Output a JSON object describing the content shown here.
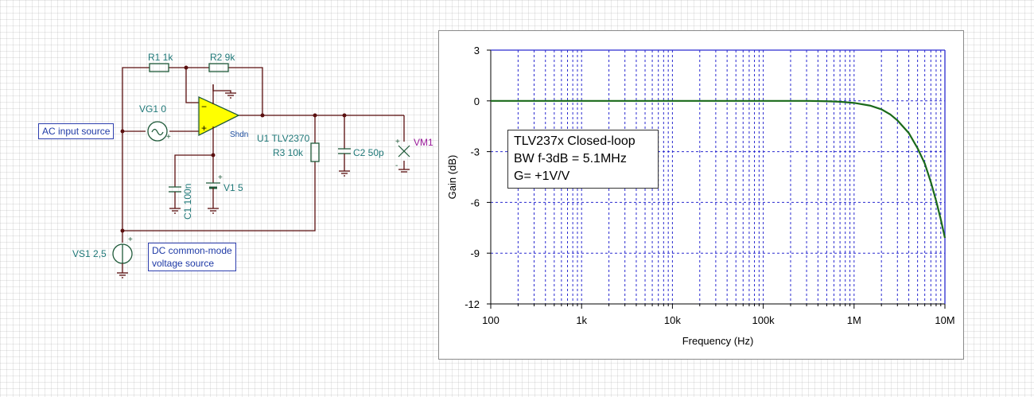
{
  "schematic": {
    "components": {
      "r1": "R1 1k",
      "r2": "R2 9k",
      "vg1": "VG1 0",
      "u1": "U1 TLV2370",
      "shdn": "Shdn",
      "r3": "R3 10k",
      "c2": "C2 50p",
      "vm1": "VM1",
      "c1": "C1 100n",
      "v1": "V1 5",
      "vs1": "VS1 2,5"
    },
    "text_boxes": {
      "ac_input": "AC input source",
      "dc_line1": "DC common-mode",
      "dc_line2": "voltage source"
    }
  },
  "colors": {
    "wire": "#5a0f0f",
    "component": "#1f5a3a",
    "label": "#1f7878",
    "opamp_fill": "#ffff00",
    "meter_label": "#9a1b9a",
    "grid": "#2a2ad0",
    "trace": "#1a6a1a"
  },
  "chart_data": {
    "type": "line",
    "x_scale": "log",
    "xlabel": "Frequency (Hz)",
    "ylabel": "Gain (dB)",
    "xlim": [
      100,
      10000000
    ],
    "ylim": [
      -12,
      3
    ],
    "x_ticks": [
      {
        "value": 100,
        "label": "100"
      },
      {
        "value": 1000,
        "label": "1k"
      },
      {
        "value": 10000,
        "label": "10k"
      },
      {
        "value": 100000,
        "label": "100k"
      },
      {
        "value": 1000000,
        "label": "1M"
      },
      {
        "value": 10000000,
        "label": "10M"
      }
    ],
    "y_ticks": [
      {
        "value": 3,
        "label": "3"
      },
      {
        "value": 0,
        "label": "0"
      },
      {
        "value": -3,
        "label": "-3"
      },
      {
        "value": -6,
        "label": "-6"
      },
      {
        "value": -9,
        "label": "-9"
      },
      {
        "value": -12,
        "label": "-12"
      }
    ],
    "grid": true,
    "series": [
      {
        "x": [
          100,
          1000,
          10000,
          100000,
          300000,
          500000,
          700000,
          1000000,
          1500000,
          2000000,
          2500000,
          3000000,
          4000000,
          5000000,
          6000000,
          7000000,
          8000000,
          9000000,
          10000000
        ],
        "values": [
          0,
          0,
          0,
          0,
          0,
          -0.02,
          -0.05,
          -0.12,
          -0.28,
          -0.5,
          -0.8,
          -1.15,
          -1.9,
          -2.8,
          -3.7,
          -4.8,
          -5.9,
          -7.0,
          -8.1
        ]
      }
    ],
    "annotation": {
      "line1": "TLV237x Closed-loop",
      "line2": "BW  f-3dB = 5.1MHz",
      "line3": "G= +1V/V"
    }
  }
}
